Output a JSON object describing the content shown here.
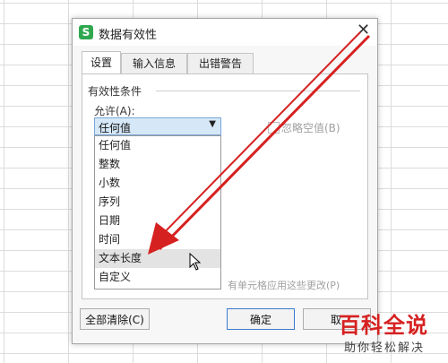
{
  "dialog": {
    "title": "数据有效性",
    "app_icon_glyph": "S",
    "close_glyph": "✕",
    "tabs": [
      {
        "label": "设置"
      },
      {
        "label": "输入信息"
      },
      {
        "label": "出错警告"
      }
    ],
    "section_title": "有效性条件",
    "allow_label": "允许(A):",
    "allow_selected": "任何值",
    "allow_options": [
      "任何值",
      "整数",
      "小数",
      "序列",
      "日期",
      "时间",
      "文本长度",
      "自定义"
    ],
    "highlighted_option": "文本长度",
    "ignore_blank_label": "忽略空值(B)",
    "apply_all_label": "有单元格应用这些更改(P)",
    "buttons": {
      "clear_all": "全部清除(C)",
      "ok": "确定",
      "cancel": "取"
    }
  },
  "watermark": {
    "title": "百科全说",
    "subtitle": "助你轻松解决"
  },
  "colors": {
    "annotation_arrow": "#d62121",
    "app_icon": "#2fa84f",
    "selection": "#d6e7f7"
  }
}
